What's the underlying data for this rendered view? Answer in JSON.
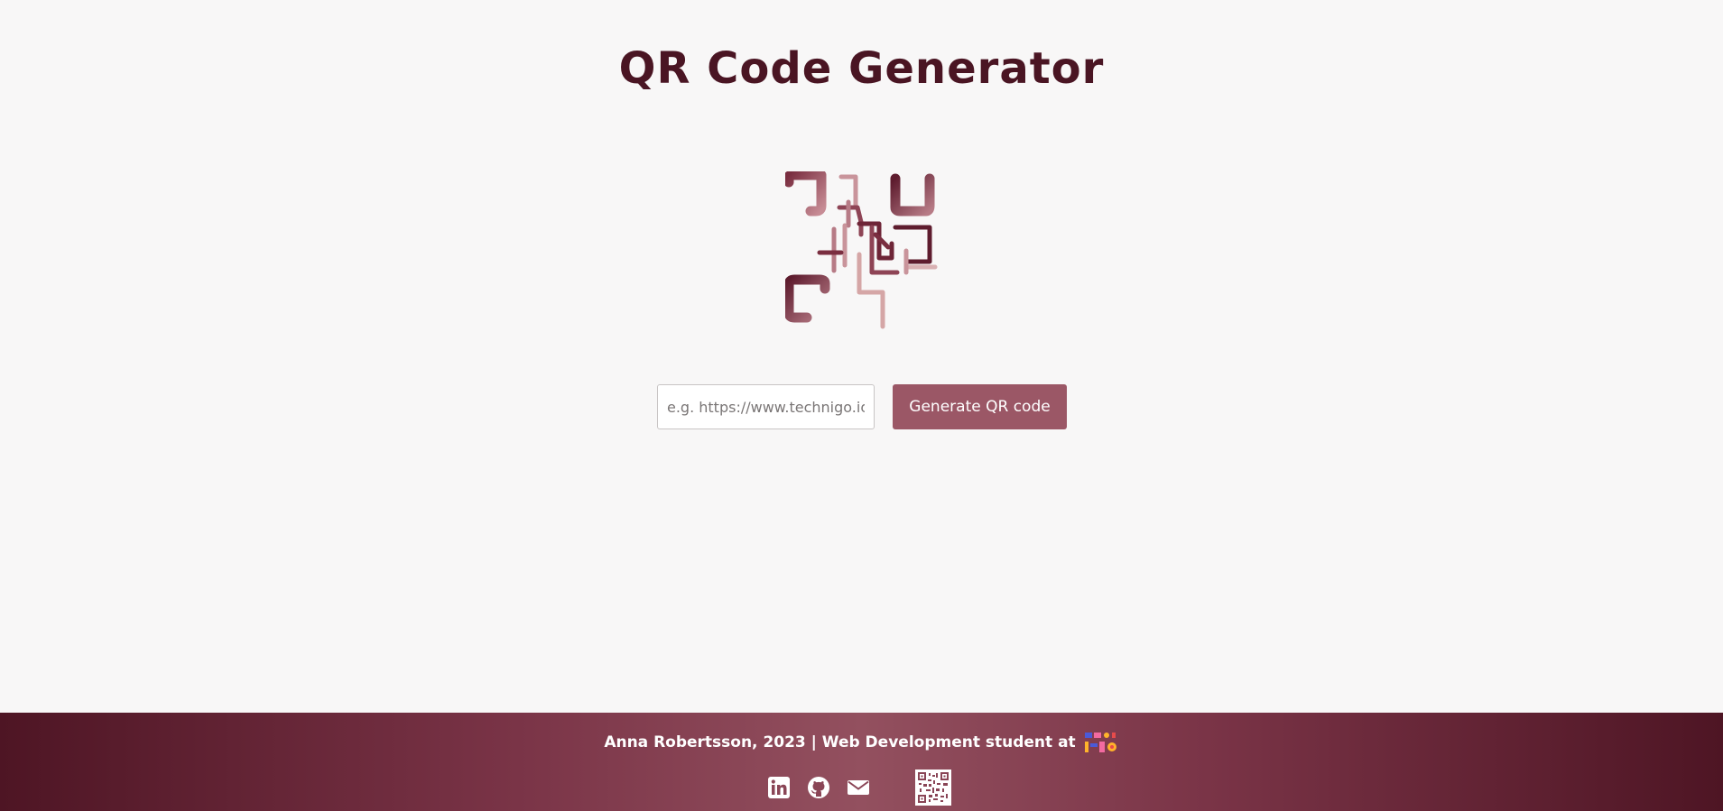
{
  "header": {
    "title": "QR Code Generator"
  },
  "form": {
    "placeholder": "e.g. https://www.technigo.io",
    "value": "",
    "button_label": "Generate QR code"
  },
  "footer": {
    "credit": "Anna Robertsson, 2023 | Web Development student at",
    "icons": [
      "linkedin-icon",
      "github-icon",
      "email-icon",
      "qr-code-icon"
    ]
  },
  "colors": {
    "title": "#4a1523",
    "button": "#9b5766",
    "footer_dark": "#4e1524",
    "footer_light": "#93505f"
  }
}
